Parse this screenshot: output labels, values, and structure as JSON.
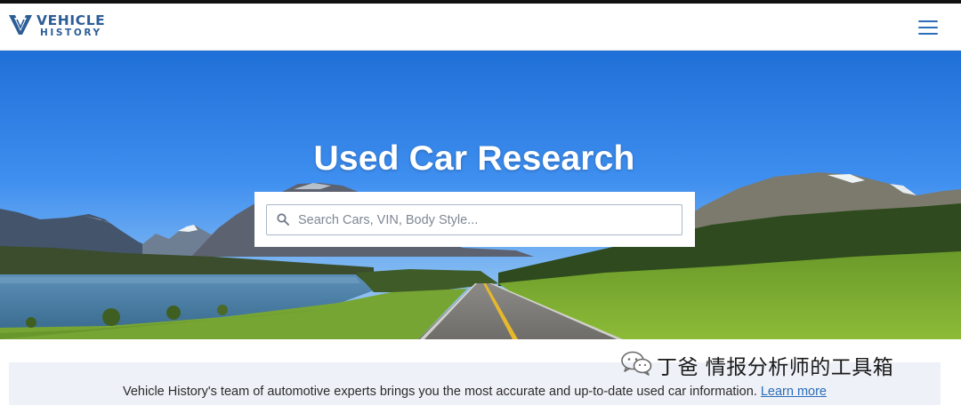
{
  "logo": {
    "line1": "VEHICLE",
    "line2": "HISTORY",
    "brand_color": "#2c5d97"
  },
  "header": {
    "menu_icon": "hamburger-menu-icon"
  },
  "hero": {
    "title": "Used Car Research",
    "search": {
      "placeholder": "Search Cars, VIN, Body Style...",
      "value": "",
      "icon": "search-icon"
    }
  },
  "info": {
    "text": "Vehicle History's team of automotive experts brings you the most accurate and up-to-date used car information. ",
    "link_label": "Learn more",
    "link_color": "#2c6db8"
  },
  "watermark": {
    "text": "丁爸 情报分析师的工具箱",
    "icon": "wechat-icon"
  }
}
